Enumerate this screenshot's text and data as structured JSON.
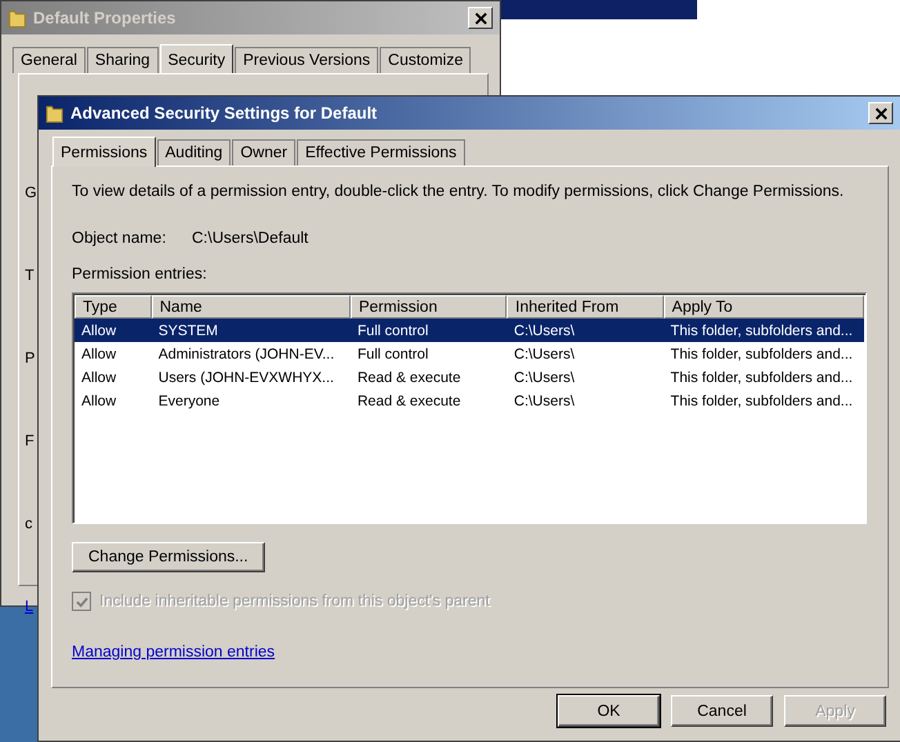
{
  "background_window": {
    "title": "Default Properties",
    "tabs": [
      {
        "label": "General",
        "selected": false
      },
      {
        "label": "Sharing",
        "selected": false
      },
      {
        "label": "Security",
        "selected": true
      },
      {
        "label": "Previous Versions",
        "selected": false
      },
      {
        "label": "Customize",
        "selected": false
      }
    ],
    "fragments": [
      {
        "text": "G",
        "kind": "label"
      },
      {
        "text": "T",
        "kind": "label"
      },
      {
        "text": "P",
        "kind": "label"
      },
      {
        "text": "F",
        "kind": "label"
      },
      {
        "text": "c",
        "kind": "label"
      },
      {
        "text": "L",
        "kind": "link"
      }
    ]
  },
  "dialog": {
    "title": "Advanced Security Settings for Default",
    "tabs": [
      {
        "label": "Permissions",
        "selected": true
      },
      {
        "label": "Auditing",
        "selected": false
      },
      {
        "label": "Owner",
        "selected": false
      },
      {
        "label": "Effective Permissions",
        "selected": false
      }
    ],
    "description": "To view details of a permission entry, double-click the entry. To modify permissions, click Change Permissions.",
    "object_name_label": "Object name:",
    "object_name_value": "C:\\Users\\Default",
    "entries_label": "Permission entries:",
    "table": {
      "columns": [
        "Type",
        "Name",
        "Permission",
        "Inherited From",
        "Apply To"
      ],
      "rows": [
        {
          "cells": [
            "Allow",
            "SYSTEM",
            "Full control",
            "C:\\Users\\",
            "This folder, subfolders and..."
          ],
          "selected": true
        },
        {
          "cells": [
            "Allow",
            "Administrators (JOHN-EV...",
            "Full control",
            "C:\\Users\\",
            "This folder, subfolders and..."
          ],
          "selected": false
        },
        {
          "cells": [
            "Allow",
            "Users (JOHN-EVXWHYX...",
            "Read & execute",
            "C:\\Users\\",
            "This folder, subfolders and..."
          ],
          "selected": false
        },
        {
          "cells": [
            "Allow",
            "Everyone",
            "Read & execute",
            "C:\\Users\\",
            "This folder, subfolders and..."
          ],
          "selected": false
        }
      ]
    },
    "change_button": "Change Permissions...",
    "inherit_checkbox": {
      "label": "Include inheritable permissions from this object's parent",
      "checked": true,
      "disabled": true
    },
    "help_link": "Managing permission entries",
    "buttons": [
      {
        "label": "OK",
        "default": true,
        "disabled": false
      },
      {
        "label": "Cancel",
        "default": false,
        "disabled": false
      },
      {
        "label": "Apply",
        "default": false,
        "disabled": true
      }
    ]
  }
}
